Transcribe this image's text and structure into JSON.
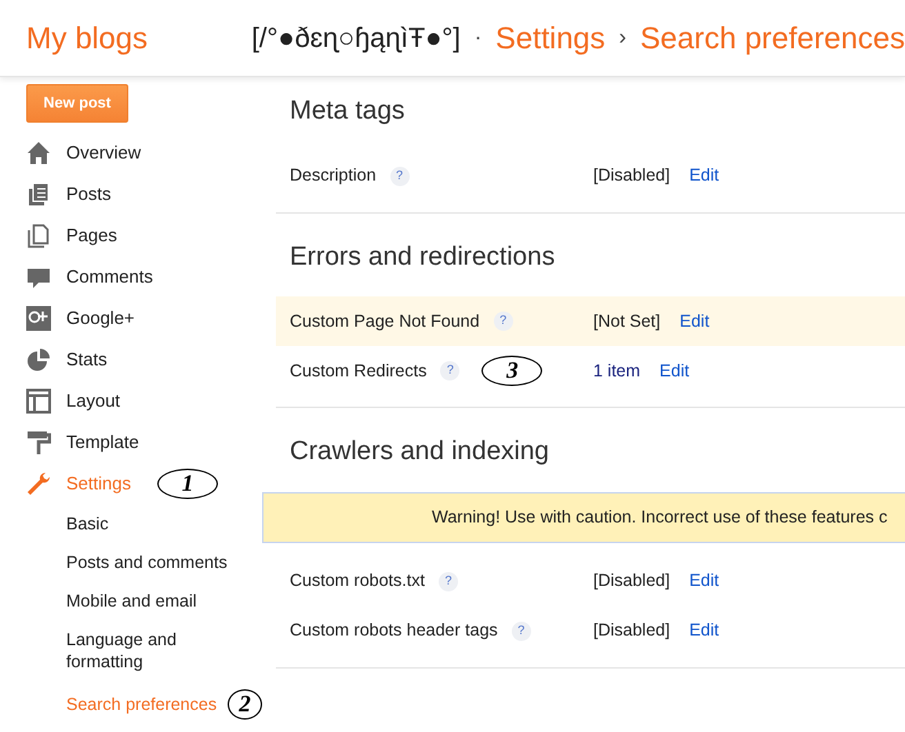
{
  "header": {
    "home": "My blogs",
    "blog_title": "[/°●ðɛɳ○ɧąɳìŦ●°]",
    "separator": "·",
    "crumbs": [
      {
        "label": "Settings"
      },
      {
        "label": "›",
        "kind": "sep"
      },
      {
        "label": "Search preferences"
      }
    ]
  },
  "sidebar": {
    "new_post": "New post",
    "items": [
      {
        "label": "Overview",
        "selected": false
      },
      {
        "label": "Posts",
        "selected": false
      },
      {
        "label": "Pages",
        "selected": false
      },
      {
        "label": "Comments",
        "selected": false
      },
      {
        "label": "Google+",
        "selected": false
      },
      {
        "label": "Stats",
        "selected": false
      },
      {
        "label": "Layout",
        "selected": false
      },
      {
        "label": "Template",
        "selected": false
      },
      {
        "label": "Settings",
        "selected": true,
        "callout": "1"
      }
    ],
    "subitems": [
      {
        "label": "Basic",
        "selected": false
      },
      {
        "label": "Posts and comments",
        "selected": false
      },
      {
        "label": "Mobile and email",
        "selected": false
      },
      {
        "label": "Language and formatting",
        "selected": false
      },
      {
        "label": "Search preferences",
        "selected": true,
        "callout": "2"
      }
    ]
  },
  "sections": [
    {
      "title": "Meta tags",
      "rows": [
        {
          "label": "Description",
          "help": "?",
          "value": "[Disabled]",
          "action": "Edit",
          "highlighted": false
        }
      ]
    },
    {
      "title": "Errors and redirections",
      "rows": [
        {
          "label": "Custom Page Not Found",
          "help": "?",
          "value": "[Not Set]",
          "action": "Edit",
          "highlighted": true
        },
        {
          "label": "Custom Redirects",
          "help": "?",
          "value": "1 item",
          "action": "Edit",
          "highlighted": false,
          "callout": "3"
        }
      ]
    },
    {
      "title": "Crawlers and indexing",
      "warning": "Warning! Use with caution. Incorrect use of these features c",
      "rows": [
        {
          "label": "Custom robots.txt",
          "help": "?",
          "value": "[Disabled]",
          "action": "Edit",
          "highlighted": false
        },
        {
          "label": "Custom robots header tags",
          "help": "?",
          "value": "[Disabled]",
          "action": "Edit",
          "highlighted": false
        }
      ]
    }
  ]
}
